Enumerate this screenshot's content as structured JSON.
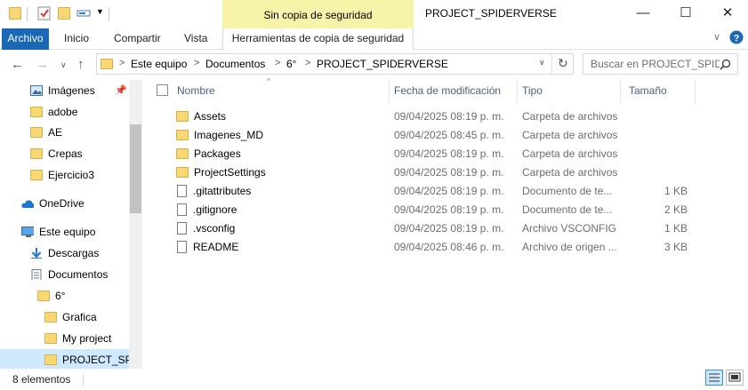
{
  "window": {
    "title": "PROJECT_SPIDERVERSE",
    "context_tab_header": "Sin copia de seguridad",
    "minimize_glyph": "—",
    "maximize_glyph": "☐",
    "close_glyph": "✕"
  },
  "ribbon": {
    "tabs": [
      "Archivo",
      "Inicio",
      "Compartir",
      "Vista"
    ],
    "context_tab": "Herramientas de copia de seguridad",
    "accent": "#1a67b6",
    "context_accent": "#f7f3a8"
  },
  "address": {
    "path": [
      "Este equipo",
      "Documentos",
      "6°",
      "PROJECT_SPIDERVERSE"
    ],
    "separator": ">",
    "search_placeholder": "Buscar en PROJECT_SPIDERVERSE"
  },
  "nav_pane": {
    "items": [
      {
        "label": "Imágenes",
        "icon": "pictures-icon",
        "pinned": true
      },
      {
        "label": "adobe",
        "icon": "folder-icon"
      },
      {
        "label": "AE",
        "icon": "folder-icon"
      },
      {
        "label": "Crepas",
        "icon": "folder-icon"
      },
      {
        "label": "Ejercicio3",
        "icon": "folder-icon"
      },
      {
        "label": "OneDrive",
        "icon": "cloud-icon"
      },
      {
        "label": "Este equipo",
        "icon": "computer-icon"
      },
      {
        "label": "Descargas",
        "icon": "download-icon"
      },
      {
        "label": "Documentos",
        "icon": "documents-icon"
      },
      {
        "label": "6°",
        "icon": "folder-icon"
      },
      {
        "label": "Grafica",
        "icon": "folder-icon"
      },
      {
        "label": "My project",
        "icon": "folder-icon"
      },
      {
        "label": "PROJECT_SPID",
        "icon": "folder-icon",
        "selected": true
      }
    ]
  },
  "file_list": {
    "columns": [
      "Nombre",
      "Fecha de modificación",
      "Tipo",
      "Tamaño"
    ],
    "rows": [
      {
        "name": "Assets",
        "date": "09/04/2025 08:19 p. m.",
        "type": "Carpeta de archivos",
        "size": "",
        "icon": "folder-icon"
      },
      {
        "name": "Imagenes_MD",
        "date": "09/04/2025 08:45 p. m.",
        "type": "Carpeta de archivos",
        "size": "",
        "icon": "folder-icon"
      },
      {
        "name": "Packages",
        "date": "09/04/2025 08:19 p. m.",
        "type": "Carpeta de archivos",
        "size": "",
        "icon": "folder-icon"
      },
      {
        "name": "ProjectSettings",
        "date": "09/04/2025 08:19 p. m.",
        "type": "Carpeta de archivos",
        "size": "",
        "icon": "folder-icon"
      },
      {
        "name": ".gitattributes",
        "date": "09/04/2025 08:19 p. m.",
        "type": "Documento de te...",
        "size": "1 KB",
        "icon": "text-file-icon"
      },
      {
        "name": ".gitignore",
        "date": "09/04/2025 08:19 p. m.",
        "type": "Documento de te...",
        "size": "2 KB",
        "icon": "text-file-icon"
      },
      {
        "name": ".vsconfig",
        "date": "09/04/2025 08:19 p. m.",
        "type": "Archivo VSCONFIG",
        "size": "1 KB",
        "icon": "file-icon"
      },
      {
        "name": "README",
        "date": "09/04/2025 08:46 p. m.",
        "type": "Archivo de origen ...",
        "size": "3 KB",
        "icon": "source-file-icon"
      }
    ]
  },
  "status": {
    "count": "8 elementos"
  }
}
